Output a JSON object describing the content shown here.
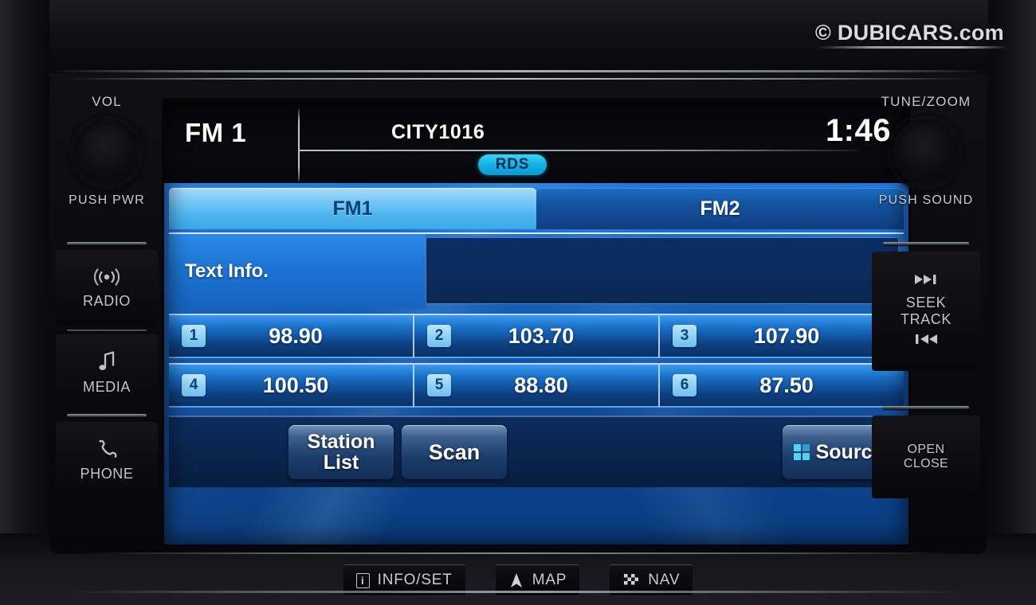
{
  "watermark": {
    "text": "© DUBICARS.com"
  },
  "screen": {
    "header": {
      "band": "FM 1",
      "station_name": "CITY1016",
      "rds_badge": "RDS",
      "clock": "1:46"
    },
    "tabs": [
      {
        "label": "FM1",
        "state": "active"
      },
      {
        "label": "FM2",
        "state": "inactive"
      }
    ],
    "text_info": {
      "label": "Text Info.",
      "value": ""
    },
    "presets": [
      {
        "number": "1",
        "frequency": "98.90"
      },
      {
        "number": "2",
        "frequency": "103.70"
      },
      {
        "number": "3",
        "frequency": "107.90"
      },
      {
        "number": "4",
        "frequency": "100.50"
      },
      {
        "number": "5",
        "frequency": "88.80"
      },
      {
        "number": "6",
        "frequency": "87.50"
      }
    ],
    "actions": {
      "station_list": "Station\nList",
      "station_list_line1": "Station",
      "station_list_line2": "List",
      "scan": "Scan",
      "source": "Source"
    },
    "colors": {
      "accent_cyan": "#4fd3f7",
      "tab_active": "#7ccbf6",
      "body_blue": "#1565c8",
      "rds_cyan": "#16b4e8"
    }
  },
  "hardkeys": {
    "left": {
      "vol_knob_top": "VOL",
      "vol_knob_bottom": "PUSH PWR",
      "radio": "RADIO",
      "radio_icon": "antenna-waves-icon",
      "media": "MEDIA",
      "media_icon": "music-note-icon",
      "phone": "PHONE",
      "phone_icon": "phone-handset-icon"
    },
    "right": {
      "tune_knob_top": "TUNE/ZOOM",
      "tune_knob_bottom": "PUSH SOUND",
      "seek_next_icon": "▶▶|",
      "seek_line1": "SEEK",
      "seek_line2": "TRACK",
      "seek_prev_icon": "|◀◀",
      "open_line1": "OPEN",
      "open_line2": "CLOSE"
    }
  },
  "softkeys": [
    {
      "label": "INFO/SET",
      "icon": "info-box-icon",
      "glyph": "i"
    },
    {
      "label": "MAP",
      "icon": "navigation-arrow-icon",
      "glyph": "▲"
    },
    {
      "label": "NAV",
      "icon": "checkered-flag-icon",
      "glyph": "▩"
    }
  ]
}
